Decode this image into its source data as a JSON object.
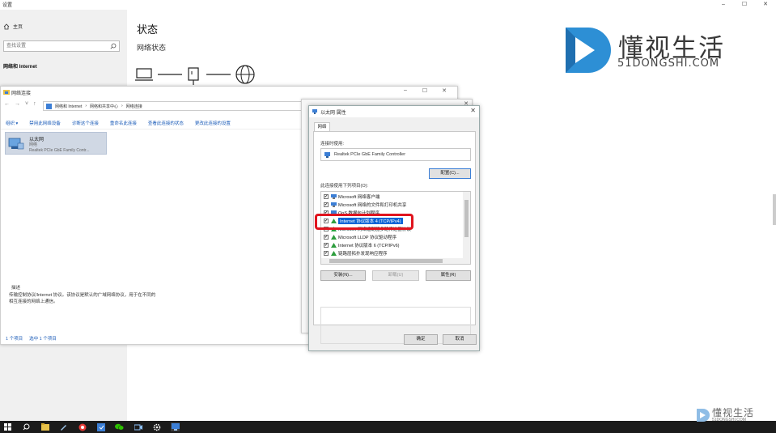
{
  "settings": {
    "window_title": "设置",
    "home_label": "主页",
    "search_placeholder": "查找设置",
    "section_label": "网络和 Internet",
    "heading": "状态",
    "subheading": "网络状态"
  },
  "watermark": {
    "brand": "懂视生活",
    "domain": "51DONGSHI.COM",
    "brand_small": "懂视生活",
    "domain_small": "51DONGSHI.COM",
    "color_primary": "#2d8fd5"
  },
  "explorer": {
    "title": "网络连接",
    "breadcrumb": [
      "网络和 Internet",
      "网络和共享中心",
      "网络连接"
    ],
    "commands": [
      "组织 ▾",
      "禁用此网络设备",
      "诊断这个连接",
      "重命名此连接",
      "查看此连接的状态",
      "更改此连接的设置"
    ],
    "adapter": {
      "name": "以太网",
      "status": "网络",
      "device": "Realtek PCIe GbE Family Contr..."
    },
    "status_bar": [
      "1 个项目",
      "选中 1 个项目"
    ]
  },
  "properties": {
    "title": "以太网 属性",
    "tab_label": "网络",
    "connect_using_label": "连接时使用:",
    "device": "Realtek PCIe GbE Family Controller",
    "configure_button": "配置(C)...",
    "items_label": "此连接使用下列项目(O):",
    "items": [
      {
        "label": "Microsoft 网络客户端",
        "checked": true,
        "selected": false
      },
      {
        "label": "Microsoft 网络的文件和打印机共享",
        "checked": true,
        "selected": false
      },
      {
        "label": "QoS 数据包计划程序",
        "checked": true,
        "selected": false
      },
      {
        "label": "Internet 协议版本 4 (TCP/IPv4)",
        "checked": true,
        "selected": true
      },
      {
        "label": "Microsoft 网络适配器多路传送器协议",
        "checked": false,
        "selected": false
      },
      {
        "label": "Microsoft LLDP 协议驱动程序",
        "checked": true,
        "selected": false
      },
      {
        "label": "Internet 协议版本 6 (TCP/IPv6)",
        "checked": true,
        "selected": false
      },
      {
        "label": "链路层拓扑发现响应程序",
        "checked": true,
        "selected": false
      }
    ],
    "install_button": "安装(N)...",
    "uninstall_button": "卸载(U)",
    "properties_button": "属性(R)",
    "description_label": "描述",
    "description_text": "传输控制协议/Internet 协议。该协议是默认的广域网络协议，用于在不同的相互连接的网络上通信。",
    "ok_button": "确定",
    "cancel_button": "取消",
    "highlight_color": "#e0141e",
    "selection_color": "#0a64d6"
  },
  "taskbar": {
    "icons": [
      "windows-start-icon",
      "search-icon",
      "file-explorer-icon",
      "pen-icon",
      "browser-icon",
      "security-icon",
      "wechat-icon",
      "camera-icon",
      "settings-gear-icon",
      "network-connections-icon"
    ]
  }
}
